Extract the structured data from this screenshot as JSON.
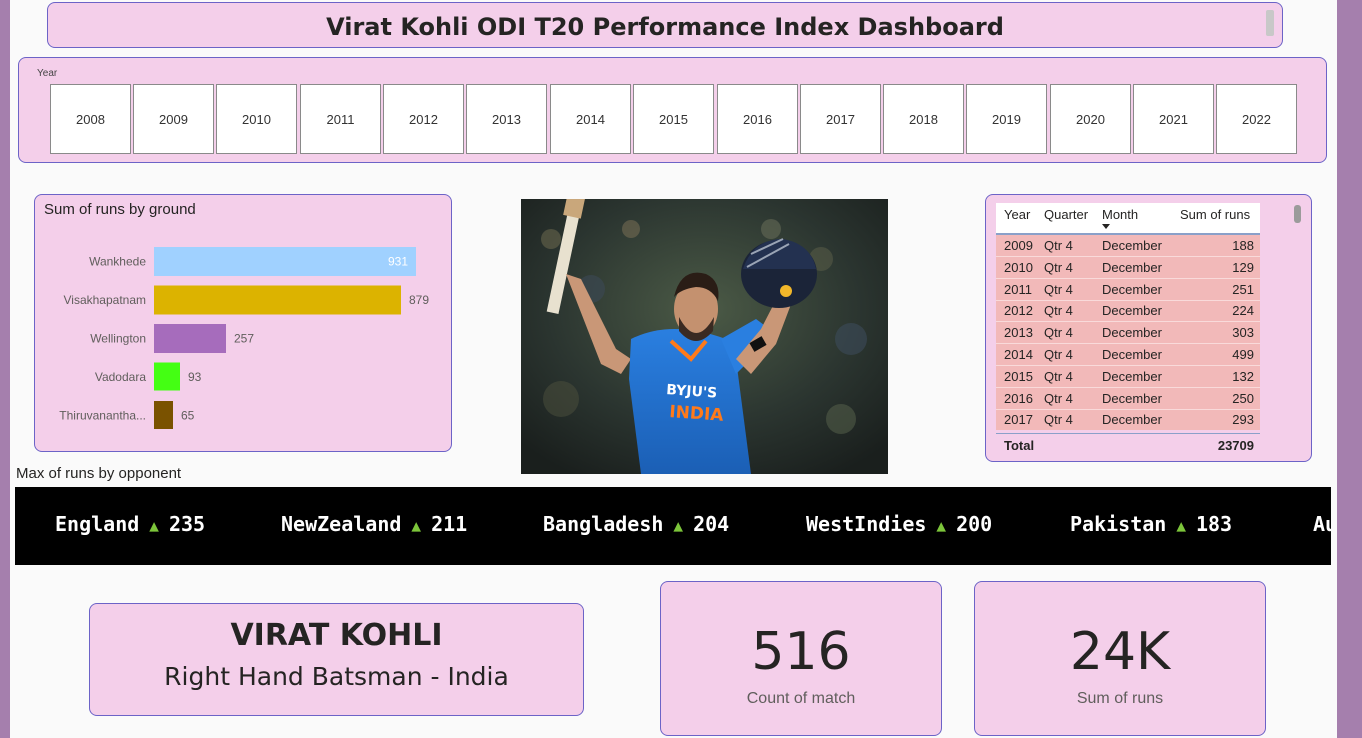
{
  "dashboard": {
    "title": "Virat Kohli ODI T20 Performance Index Dashboard"
  },
  "year_slicer": {
    "label": "Year",
    "years": [
      "2008",
      "2009",
      "2010",
      "2011",
      "2012",
      "2013",
      "2014",
      "2015",
      "2016",
      "2017",
      "2018",
      "2019",
      "2020",
      "2021",
      "2022"
    ]
  },
  "ground_chart": {
    "title": "Sum of runs by ground"
  },
  "chart_data": {
    "type": "bar",
    "orientation": "horizontal",
    "title": "Sum of runs by ground",
    "categories": [
      "Wankhede",
      "Visakhapatnam",
      "Wellington",
      "Vadodara",
      "Thiruvanantha..."
    ],
    "values": [
      931,
      879,
      257,
      93,
      65
    ],
    "bar_colors": [
      "#a0d1ff",
      "#dcb300",
      "#a66cbc",
      "#44ff13",
      "#7a5200"
    ],
    "xlim": [
      0,
      1000
    ],
    "grid": false,
    "data_labels": true
  },
  "photo": {
    "alt": "Virat Kohli celebrating, raising bat and helmet",
    "jersey_text": "BYJU'S INDIA",
    "colors": {
      "jersey": "#1f6fd1",
      "background": "#2a2f2a",
      "helmet": "#1b2438"
    }
  },
  "matrix": {
    "headers": {
      "year": "Year",
      "quarter": "Quarter",
      "month": "Month",
      "sum": "Sum of runs"
    },
    "rows": [
      {
        "year": "2009",
        "quarter": "Qtr 4",
        "month": "December",
        "runs": "188"
      },
      {
        "year": "2010",
        "quarter": "Qtr 4",
        "month": "December",
        "runs": "129"
      },
      {
        "year": "2011",
        "quarter": "Qtr 4",
        "month": "December",
        "runs": "251"
      },
      {
        "year": "2012",
        "quarter": "Qtr 4",
        "month": "December",
        "runs": "224"
      },
      {
        "year": "2013",
        "quarter": "Qtr 4",
        "month": "December",
        "runs": "303"
      },
      {
        "year": "2014",
        "quarter": "Qtr 4",
        "month": "December",
        "runs": "499"
      },
      {
        "year": "2015",
        "quarter": "Qtr 4",
        "month": "December",
        "runs": "132"
      },
      {
        "year": "2016",
        "quarter": "Qtr 4",
        "month": "December",
        "runs": "250"
      },
      {
        "year": "2017",
        "quarter": "Qtr 4",
        "month": "December",
        "runs": "293"
      }
    ],
    "total_label": "Total",
    "total_value": "23709"
  },
  "opponent": {
    "label": "Max of runs by opponent",
    "arrow": "▲",
    "items": [
      {
        "name": "England",
        "value": "235"
      },
      {
        "name": "NewZealand",
        "value": "211"
      },
      {
        "name": "Bangladesh",
        "value": "204"
      },
      {
        "name": "WestIndies",
        "value": "200"
      },
      {
        "name": "Pakistan",
        "value": "183"
      },
      {
        "name": "Au",
        "value": ""
      }
    ]
  },
  "player": {
    "name": "VIRAT KOHLI",
    "role": "Right Hand Batsman - India"
  },
  "kpis": {
    "matches": {
      "value": "516",
      "label": "Count of match"
    },
    "runs": {
      "value": "24K",
      "label": "Sum of runs"
    }
  },
  "colors": {
    "card_bg": "#f4cfea",
    "card_border": "#6c63c7",
    "frame": "#a57fad",
    "table_row": "#f2b9b9",
    "ticker_arrow": "#7cc53a"
  }
}
